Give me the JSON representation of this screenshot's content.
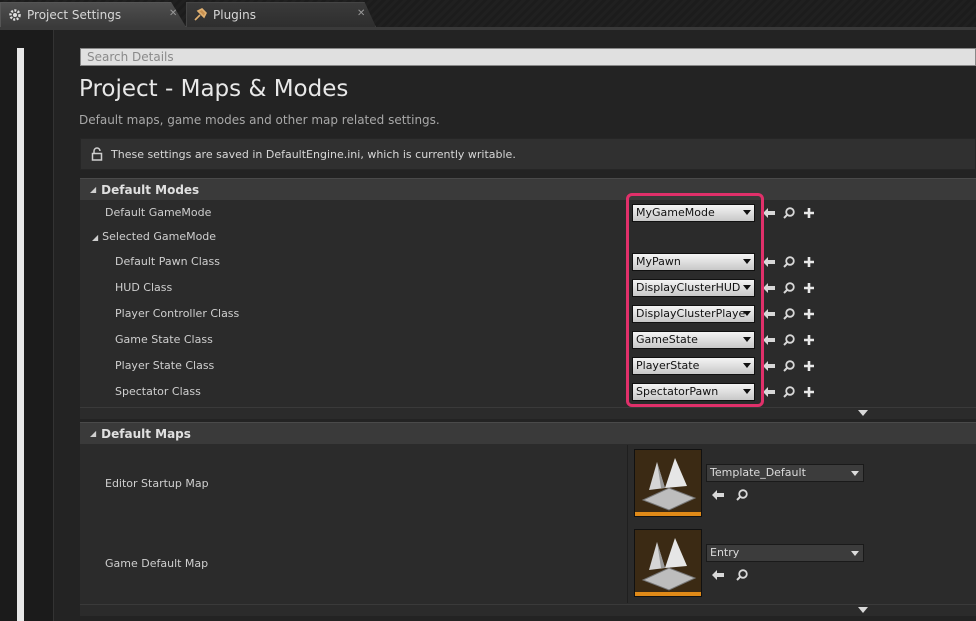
{
  "tabs": [
    {
      "label": "Project Settings",
      "icon": "gear-icon",
      "active": true
    },
    {
      "label": "Plugins",
      "icon": "plug-icon",
      "active": false
    }
  ],
  "search": {
    "placeholder": "Search Details"
  },
  "page": {
    "title": "Project - Maps & Modes",
    "subtitle": "Default maps, game modes and other map related settings."
  },
  "notice": {
    "text": "These settings are saved in DefaultEngine.ini, which is currently writable."
  },
  "default_modes": {
    "header": "Default Modes",
    "default_gamemode": {
      "label": "Default GameMode",
      "value": "MyGameMode"
    },
    "selected_gamemode": {
      "label": "Selected GameMode"
    },
    "rows": [
      {
        "label": "Default Pawn Class",
        "value": "MyPawn"
      },
      {
        "label": "HUD Class",
        "value": "DisplayClusterHUD"
      },
      {
        "label": "Player Controller Class",
        "value": "DisplayClusterPlayerController"
      },
      {
        "label": "Game State Class",
        "value": "GameState"
      },
      {
        "label": "Player State Class",
        "value": "PlayerState"
      },
      {
        "label": "Spectator Class",
        "value": "SpectatorPawn"
      }
    ]
  },
  "default_maps": {
    "header": "Default Maps",
    "rows": [
      {
        "label": "Editor Startup Map",
        "value": "Template_Default"
      },
      {
        "label": "Game Default Map",
        "value": "Entry"
      }
    ]
  },
  "colors": {
    "highlight": "#e0306a",
    "thumbnail_bar": "#e08a18"
  }
}
